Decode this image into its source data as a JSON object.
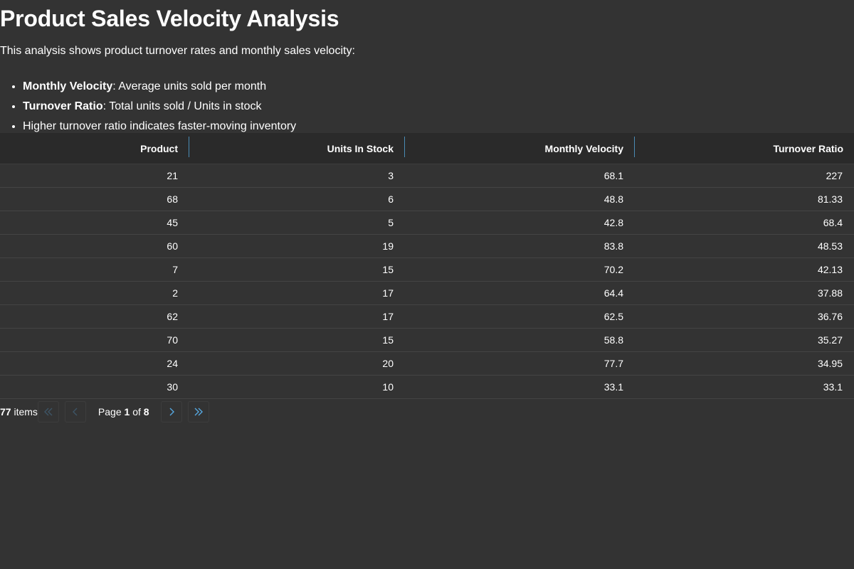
{
  "title": "Product Sales Velocity Analysis",
  "intro": "This analysis shows product turnover rates and monthly sales velocity:",
  "notes": [
    {
      "term": "Monthly Velocity",
      "text": ": Average units sold per month"
    },
    {
      "term": "Turnover Ratio",
      "text": ": Total units sold / Units in stock"
    },
    {
      "term": "",
      "text": "Higher turnover ratio indicates faster-moving inventory"
    }
  ],
  "table": {
    "columns": [
      "Product",
      "Units In Stock",
      "Monthly Velocity",
      "Turnover Ratio"
    ],
    "rows": [
      [
        "21",
        "3",
        "68.1",
        "227"
      ],
      [
        "68",
        "6",
        "48.8",
        "81.33"
      ],
      [
        "45",
        "5",
        "42.8",
        "68.4"
      ],
      [
        "60",
        "19",
        "83.8",
        "48.53"
      ],
      [
        "7",
        "15",
        "70.2",
        "42.13"
      ],
      [
        "2",
        "17",
        "64.4",
        "37.88"
      ],
      [
        "62",
        "17",
        "62.5",
        "36.76"
      ],
      [
        "70",
        "15",
        "58.8",
        "35.27"
      ],
      [
        "24",
        "20",
        "77.7",
        "34.95"
      ],
      [
        "30",
        "10",
        "33.1",
        "33.1"
      ]
    ]
  },
  "pager": {
    "total_items": "77",
    "items_label": "items",
    "page_label": "Page",
    "current_page": "1",
    "of_label": "of",
    "total_pages": "8",
    "icons": [
      "first-page-icon",
      "previous-page-icon",
      "next-page-icon",
      "last-page-icon"
    ]
  },
  "colors": {
    "background": "#333333",
    "header_background": "#2a2a2a",
    "accent": "#56a8e0",
    "column_separator": "#4a8bb5"
  }
}
